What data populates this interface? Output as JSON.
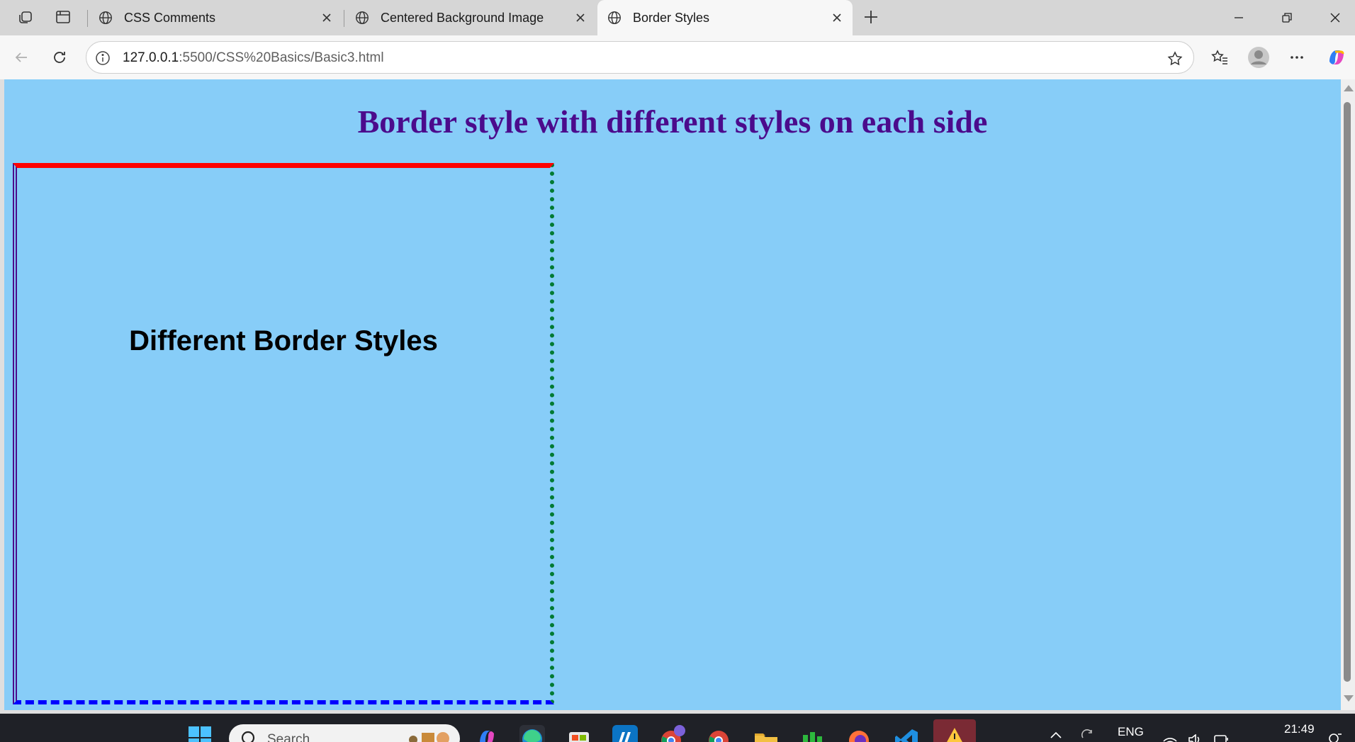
{
  "browser": {
    "tabs": [
      {
        "label": "CSS Comments"
      },
      {
        "label": "Centered Background Image"
      },
      {
        "label": "Border Styles",
        "active": true
      }
    ],
    "address": {
      "host": "127.0.0.1",
      "path": ":5500/CSS%20Basics/Basic3.html"
    }
  },
  "page": {
    "heading": "Border style with different styles on each side",
    "box_text": "Different Border Styles",
    "colors": {
      "background": "#87cdf8",
      "heading": "#4b0b8c",
      "border_top": "#ff0000",
      "border_right": "#007a33",
      "border_bottom": "#0000ff",
      "border_left": "#4b0b8c"
    }
  },
  "taskbar": {
    "search_placeholder": "Search",
    "language": "ENG",
    "time": "21:49",
    "apps": [
      "windows-start-icon",
      "copilot-icon",
      "edge-icon",
      "store-icon",
      "myhp-icon",
      "chrome-profile-icon",
      "chrome-icon",
      "file-explorer-icon",
      "app-green-icon",
      "firefox-icon",
      "vscode-icon",
      "warning-app-icon"
    ]
  }
}
